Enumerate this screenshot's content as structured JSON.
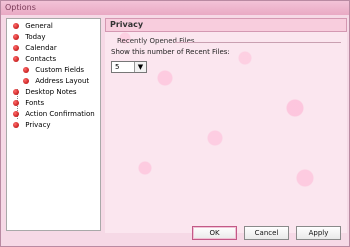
{
  "window": {
    "title": "Options"
  },
  "sidebar": {
    "items": [
      {
        "label": "General"
      },
      {
        "label": "Today"
      },
      {
        "label": "Calendar"
      },
      {
        "label": "Contacts"
      },
      {
        "label": "Custom Fields"
      },
      {
        "label": "Address Layout"
      },
      {
        "label": "Desktop Notes"
      },
      {
        "label": "Fonts"
      },
      {
        "label": "Action Confirmation"
      },
      {
        "label": "Privacy"
      }
    ]
  },
  "panel": {
    "title": "Privacy",
    "group_title": "Recently Opened Files",
    "field_label": "Show this number of Recent Files:",
    "recent_files_value": "5"
  },
  "buttons": {
    "ok": "OK",
    "cancel": "Cancel",
    "apply": "Apply"
  },
  "colors": {
    "window_bg": "#f6d9e6",
    "accent": "#c25a87",
    "bullet": "#d00000"
  }
}
